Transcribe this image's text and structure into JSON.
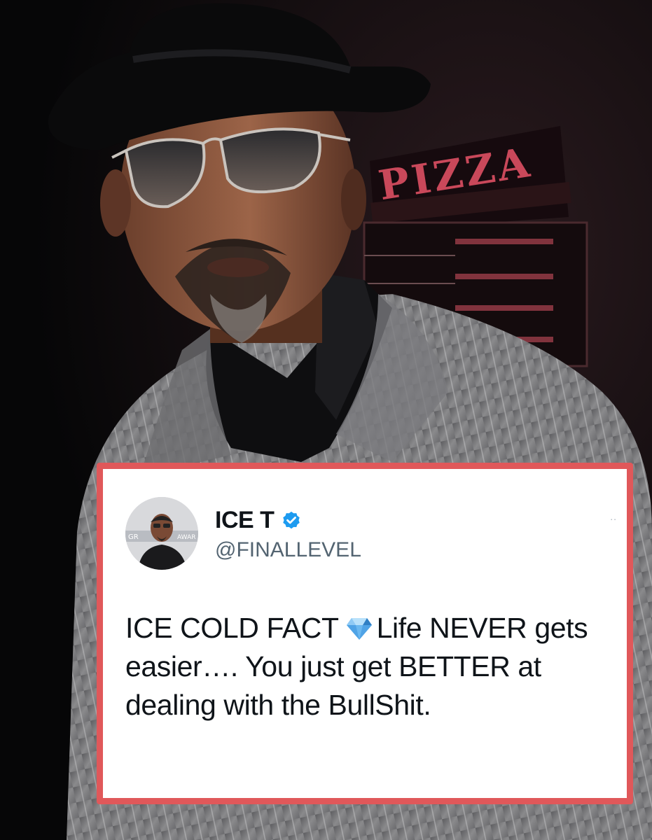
{
  "background_photo": {
    "sign_text": "PIZZA",
    "hat_icon": "fedora-hat-icon",
    "sunglasses_icon": "aviator-sunglasses-icon"
  },
  "tweet": {
    "display_name": "ICE T",
    "handle": "@FINALLEVEL",
    "verified_icon": "verified-badge-icon",
    "more_icon": "..",
    "text_part1": "ICE COLD FACT",
    "emoji_icon": "gem-stone-icon",
    "text_part2": "Life NEVER gets easier…. You just get BETTER at dealing with the BullShit.",
    "avatar_text_left": "GR",
    "avatar_text_right": "AWAR"
  },
  "colors": {
    "card_border": "#e0585a",
    "verified_blue": "#1d9bf0",
    "handle_gray": "#536471",
    "text_black": "#0f1419"
  }
}
